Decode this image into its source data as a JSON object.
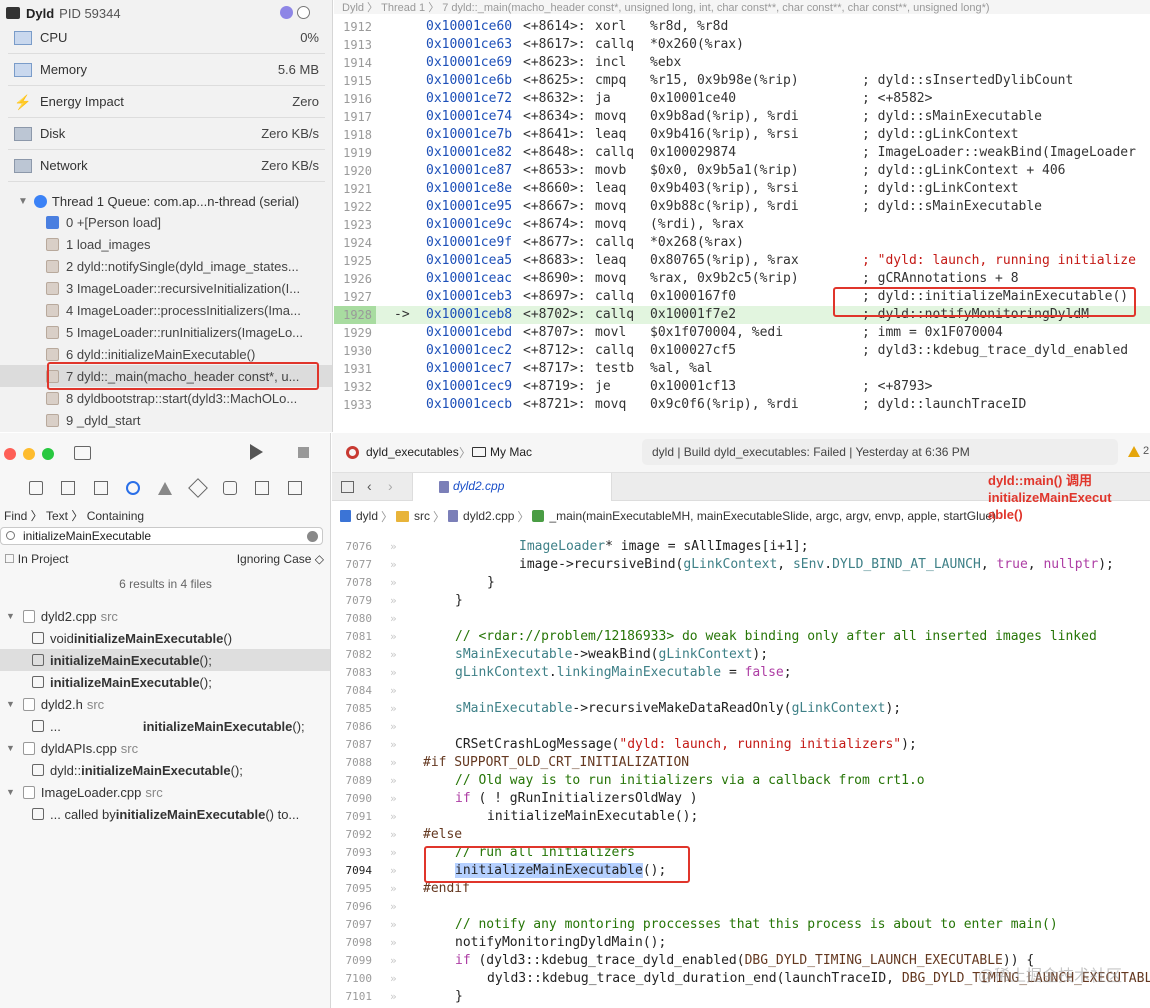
{
  "debug_navigator": {
    "process_name": "Dyld",
    "process_pid": "PID 59344",
    "gauges": [
      {
        "label": "CPU",
        "value": "0%",
        "icon": "cpu-icon"
      },
      {
        "label": "Memory",
        "value": "5.6 MB",
        "icon": "memory-icon"
      },
      {
        "label": "Energy Impact",
        "value": "Zero",
        "icon": "energy-icon"
      },
      {
        "label": "Disk",
        "value": "Zero KB/s",
        "icon": "disk-icon"
      },
      {
        "label": "Network",
        "value": "Zero KB/s",
        "icon": "network-icon"
      }
    ],
    "thread": "Thread 1 Queue: com.ap...n-thread (serial)",
    "frames": [
      "0 +[Person load]",
      "1 load_images",
      "2 dyld::notifySingle(dyld_image_states...",
      "3 ImageLoader::recursiveInitialization(I...",
      "4 ImageLoader::processInitializers(Ima...",
      "5 ImageLoader::runInitializers(ImageLo...",
      "6 dyld::initializeMainExecutable()",
      "7 dyld::_main(macho_header const*, u...",
      "8 dyldbootstrap::start(dyld3::MachOLo...",
      "9 _dyld_start"
    ],
    "selected_frame": 7
  },
  "disassembly": {
    "jumpbar": "Dyld 〉 Thread 1 〉 7 dyld::_main(macho_header const*, unsigned long, int, char const**, char const**, char const**, unsigned long*)",
    "lines": [
      {
        "ln": "1912",
        "addr": "0x10001ce60",
        "off": "<+8614>:",
        "mn": "xorl",
        "ops": "%r8d, %r8d",
        "cm": ""
      },
      {
        "ln": "1913",
        "addr": "0x10001ce63",
        "off": "<+8617>:",
        "mn": "callq",
        "ops": "*0x260(%rax)",
        "cm": ""
      },
      {
        "ln": "1914",
        "addr": "0x10001ce69",
        "off": "<+8623>:",
        "mn": "incl",
        "ops": "%ebx",
        "cm": ""
      },
      {
        "ln": "1915",
        "addr": "0x10001ce6b",
        "off": "<+8625>:",
        "mn": "cmpq",
        "ops": "%r15, 0x9b98e(%rip)",
        "cm": "; dyld::sInsertedDylibCount"
      },
      {
        "ln": "1916",
        "addr": "0x10001ce72",
        "off": "<+8632>:",
        "mn": "ja",
        "ops": "0x10001ce40",
        "cm": "; <+8582>"
      },
      {
        "ln": "1917",
        "addr": "0x10001ce74",
        "off": "<+8634>:",
        "mn": "movq",
        "ops": "0x9b8ad(%rip), %rdi",
        "cm": "; dyld::sMainExecutable"
      },
      {
        "ln": "1918",
        "addr": "0x10001ce7b",
        "off": "<+8641>:",
        "mn": "leaq",
        "ops": "0x9b416(%rip), %rsi",
        "cm": "; dyld::gLinkContext"
      },
      {
        "ln": "1919",
        "addr": "0x10001ce82",
        "off": "<+8648>:",
        "mn": "callq",
        "ops": "0x100029874",
        "cm": "; ImageLoader::weakBind(ImageLoader"
      },
      {
        "ln": "1920",
        "addr": "0x10001ce87",
        "off": "<+8653>:",
        "mn": "movb",
        "ops": "$0x0, 0x9b5a1(%rip)",
        "cm": "; dyld::gLinkContext + 406"
      },
      {
        "ln": "1921",
        "addr": "0x10001ce8e",
        "off": "<+8660>:",
        "mn": "leaq",
        "ops": "0x9b403(%rip), %rsi",
        "cm": "; dyld::gLinkContext"
      },
      {
        "ln": "1922",
        "addr": "0x10001ce95",
        "off": "<+8667>:",
        "mn": "movq",
        "ops": "0x9b88c(%rip), %rdi",
        "cm": "; dyld::sMainExecutable"
      },
      {
        "ln": "1923",
        "addr": "0x10001ce9c",
        "off": "<+8674>:",
        "mn": "movq",
        "ops": "(%rdi), %rax",
        "cm": ""
      },
      {
        "ln": "1924",
        "addr": "0x10001ce9f",
        "off": "<+8677>:",
        "mn": "callq",
        "ops": "*0x268(%rax)",
        "cm": ""
      },
      {
        "ln": "1925",
        "addr": "0x10001cea5",
        "off": "<+8683>:",
        "mn": "leaq",
        "ops": "0x80765(%rip), %rax",
        "cm": "; \"dyld: launch, running initialize"
      },
      {
        "ln": "1926",
        "addr": "0x10001ceac",
        "off": "<+8690>:",
        "mn": "movq",
        "ops": "%rax, 0x9b2c5(%rip)",
        "cm": "; gCRAnnotations + 8"
      },
      {
        "ln": "1927",
        "addr": "0x10001ceb3",
        "off": "<+8697>:",
        "mn": "callq",
        "ops": "0x1000167f0",
        "cm": "; dyld::initializeMainExecutable()"
      },
      {
        "ln": "1928",
        "addr": "0x10001ceb8",
        "off": "<+8702>:",
        "mn": "callq",
        "ops": "0x10001f7e2",
        "cm": "; dyld::notifyMonitoringDyldM"
      },
      {
        "ln": "1929",
        "addr": "0x10001cebd",
        "off": "<+8707>:",
        "mn": "movl",
        "ops": "$0x1f070004, %edi",
        "cm": "; imm = 0x1F070004"
      },
      {
        "ln": "1930",
        "addr": "0x10001cec2",
        "off": "<+8712>:",
        "mn": "callq",
        "ops": "0x100027cf5",
        "cm": "; dyld3::kdebug_trace_dyld_enabled"
      },
      {
        "ln": "1931",
        "addr": "0x10001cec7",
        "off": "<+8717>:",
        "mn": "testb",
        "ops": "%al, %al",
        "cm": ""
      },
      {
        "ln": "1932",
        "addr": "0x10001cec9",
        "off": "<+8719>:",
        "mn": "je",
        "ops": "0x10001cf13",
        "cm": "; <+8793>"
      },
      {
        "ln": "1933",
        "addr": "0x10001cecb",
        "off": "<+8721>:",
        "mn": "movq",
        "ops": "0x9c0f6(%rip), %rdi",
        "cm": "; dyld::launchTraceID"
      }
    ],
    "current_line": "1928",
    "pc_arrow": "->"
  },
  "find_navigator": {
    "path": "Find 〉 Text 〉 Containing",
    "query": "initializeMainExecutable",
    "scope": "In Project",
    "case_mode": "Ignoring Case ◇",
    "result_count": "6 results in 4 files",
    "files": [
      {
        "name": "dyld2.cpp",
        "folder": "src",
        "kind": "c++",
        "matches": [
          {
            "prefix": "void ",
            "match": "initializeMainExecutable",
            "suffix": "()",
            "selected": false
          },
          {
            "prefix": "",
            "match": "initializeMainExecutable",
            "suffix": "();",
            "selected": true
          },
          {
            "prefix": "",
            "match": "initializeMainExecutable",
            "suffix": "();",
            "selected": false
          }
        ]
      },
      {
        "name": "dyld2.h",
        "folder": "src",
        "kind": "h",
        "matches": [
          {
            "prefix": "...",
            "match": "initializeMainExecutable",
            "suffix": "();",
            "selected": false
          }
        ]
      },
      {
        "name": "dyldAPIs.cpp",
        "folder": "src",
        "kind": "c++",
        "matches": [
          {
            "prefix": "dyld::",
            "match": "initializeMainExecutable",
            "suffix": "();",
            "selected": false
          }
        ]
      },
      {
        "name": "ImageLoader.cpp",
        "folder": "src",
        "kind": "c++",
        "matches": [
          {
            "prefix": "... called by ",
            "match": "initializeMainExecutable",
            "suffix": "() to...",
            "selected": false
          }
        ]
      }
    ]
  },
  "editor": {
    "scheme": "dyld_executables",
    "destination": "My Mac",
    "status": "dyld | Build dyld_executables: Failed | Yesterday at 6:36 PM",
    "warning_count": "2",
    "tab": "dyld2.cpp",
    "jumpbar": [
      "dyld",
      "src",
      "dyld2.cpp",
      "_main(mainExecutableMH, mainExecutableSlide, argc, argv, envp, apple, startGlue)"
    ],
    "current_line": "7094"
  },
  "annotation": {
    "lines": [
      "dyld::main() 调用",
      "initializeMainExecut",
      "able()"
    ]
  },
  "watermark": "@稀土掘金技术社区",
  "colors": {
    "annotation_red": "#e0352b",
    "current_line_green": "#e2f5df",
    "address_blue": "#1c4fb8"
  }
}
